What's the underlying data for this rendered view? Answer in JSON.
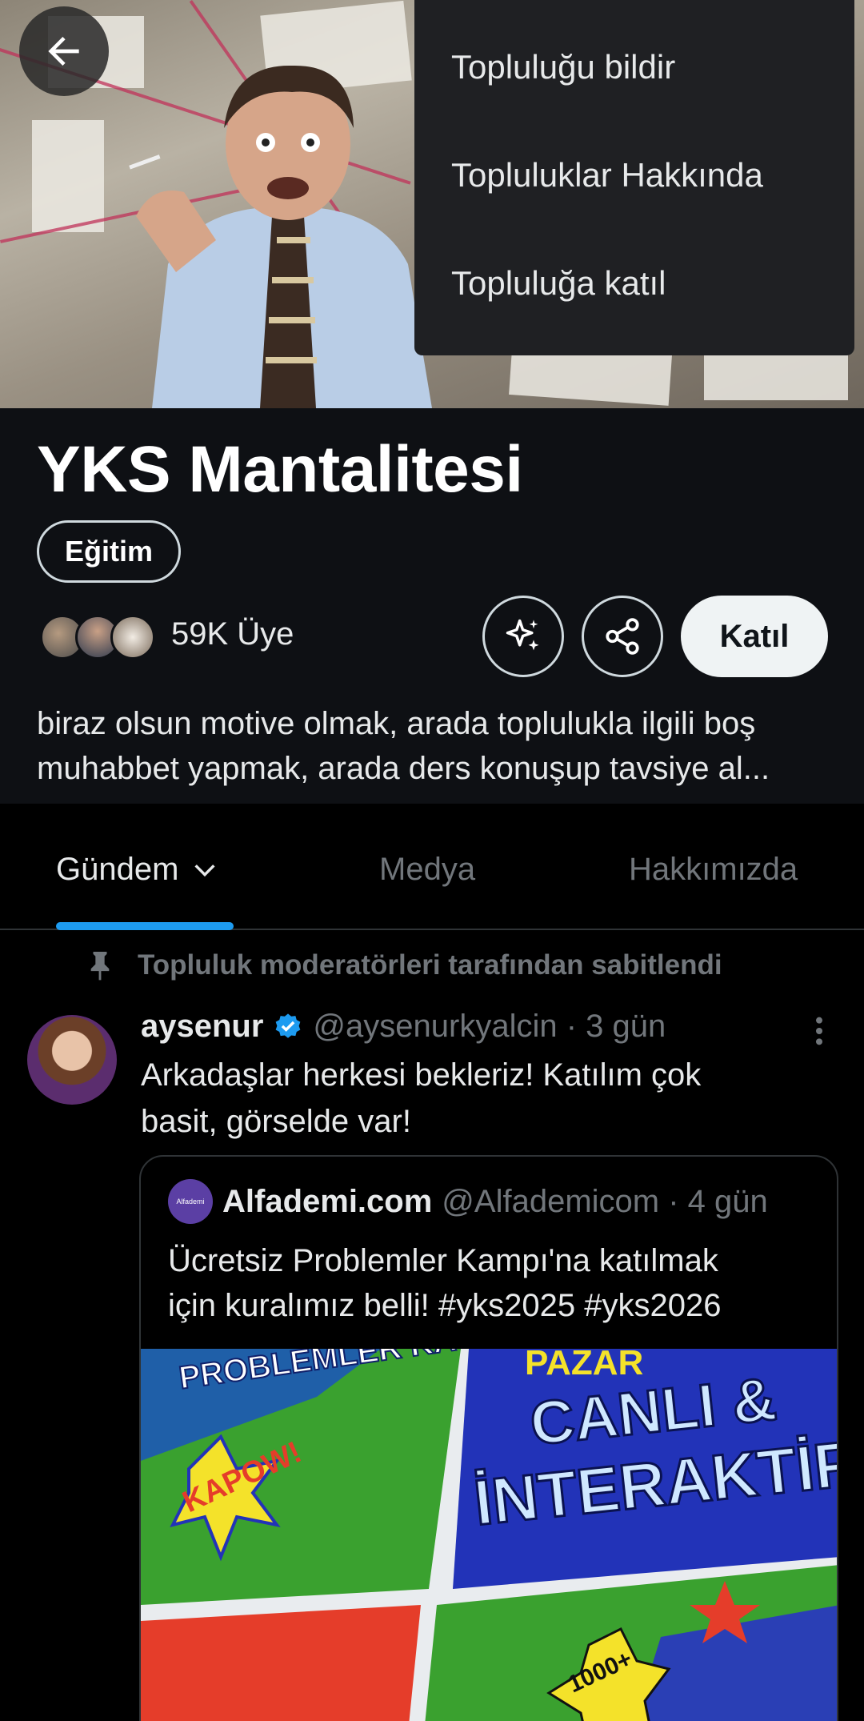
{
  "menu": {
    "items": [
      "Topluluğu bildir",
      "Topluluklar Hakkında",
      "Topluluğa katıl"
    ]
  },
  "community": {
    "name": "YKS Mantalitesi",
    "category": "Eğitim",
    "members": "59K Üye",
    "join_label": "Katıl",
    "description_line1": "biraz olsun motive olmak, arada toplulukla ilgili boş",
    "description_line2": "muhabbet yapmak, arada ders konuşup tavsiye al..."
  },
  "tabs": [
    "Gündem",
    "Medya",
    "Hakkımızda"
  ],
  "pinned_label": "Topluluk moderatörleri tarafından sabitlendi",
  "post": {
    "name": "aysenur",
    "handle": "@aysenurkyalcin · 3 gün",
    "text_line1": "Arkadaşlar herkesi bekleriz! Katılım çok",
    "text_line2": "basit, görselde var!",
    "quote": {
      "logo_text": "Alfademi",
      "name": "Alfademi.com",
      "handle": "@Alfademicom · 4 gün",
      "text_line1": "Ücretsiz Problemler Kampı'na katılmak",
      "text_line2": "için kuralımız belli! #yks2025  #yks2026",
      "media_text": {
        "top_left": "PROBLEMLER KA",
        "kapow": "KAPOW!",
        "top_right": "PAZAR",
        "canli": "CANLI &",
        "interaktif": "İNTERAKTİF",
        "badge": "1000+"
      }
    }
  },
  "colors": {
    "accent": "#1d9bf0",
    "background": "#000000",
    "header_bg": "#0e1014",
    "menu_bg": "#1f2023"
  }
}
